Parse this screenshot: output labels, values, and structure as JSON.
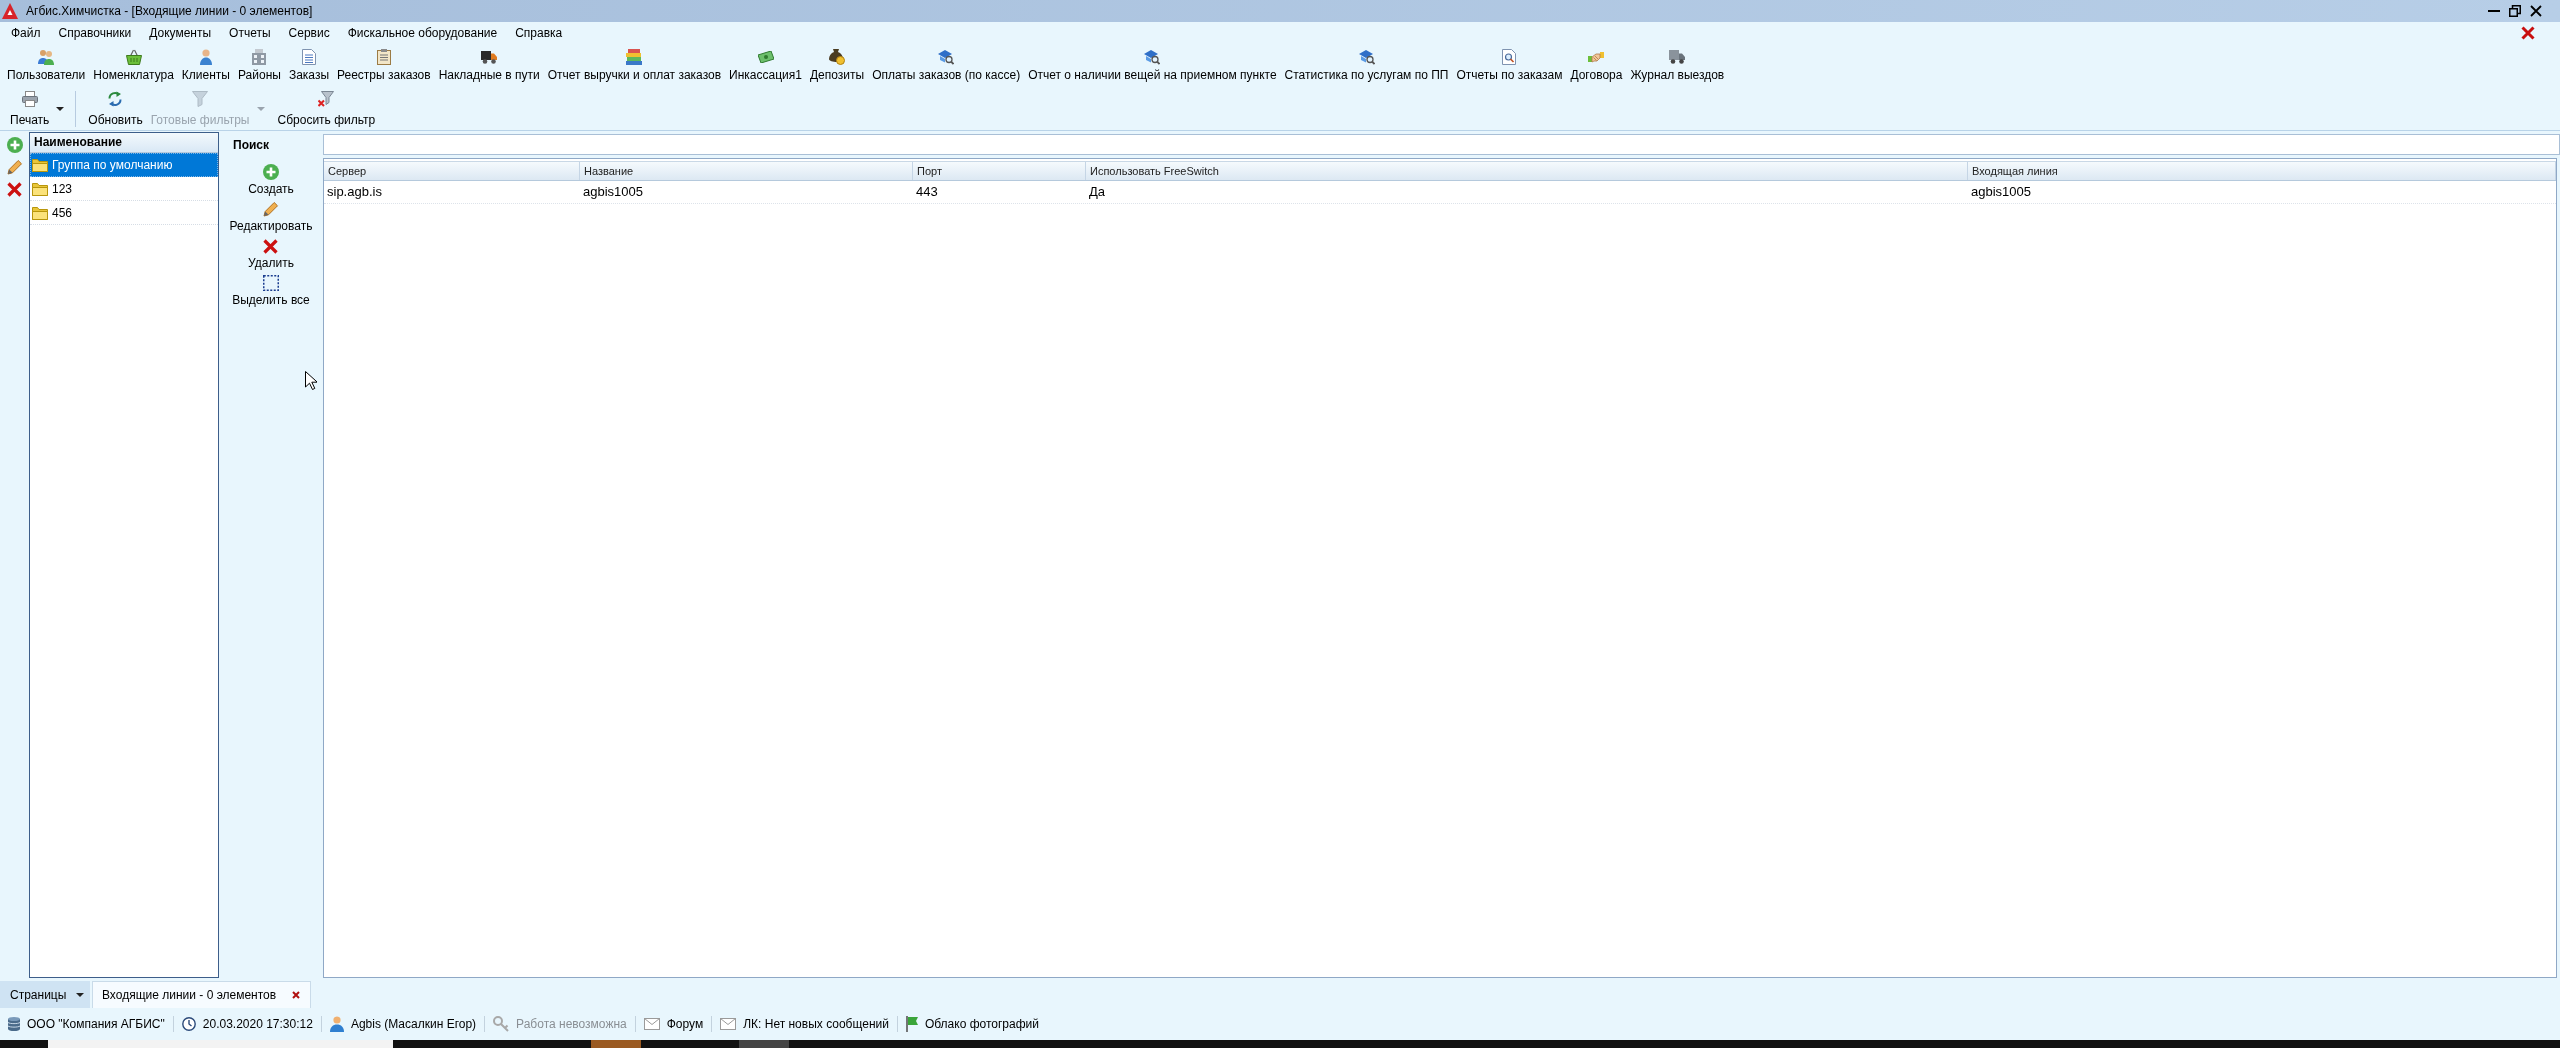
{
  "window": {
    "title": "Агбис.Химчистка - [Входящие линии - 0 элементов]"
  },
  "menu": [
    "Файл",
    "Справочники",
    "Документы",
    "Отчеты",
    "Сервис",
    "Фискальное оборудование",
    "Справка"
  ],
  "toolbar": [
    "Пользователи",
    "Номенклатура",
    "Клиенты",
    "Районы",
    "Заказы",
    "Реестры заказов",
    "Накладные в пути",
    "Отчет выручки и оплат заказов",
    "Инкассация1",
    "Депозиты",
    "Оплаты заказов (по кассе)",
    "Отчет о наличии вещей на приемном пункте",
    "Статистика по услугам по ПП",
    "Отчеты по заказам",
    "Договора",
    "Журнал выездов"
  ],
  "action_groups": [
    [
      {
        "label": "Печать",
        "disabled": false,
        "dropdown": true
      }
    ],
    [
      {
        "label": "Обновить",
        "disabled": false,
        "dropdown": false
      },
      {
        "label": "Готовые фильтры",
        "disabled": true,
        "dropdown": true
      },
      {
        "label": "Сбросить фильтр",
        "disabled": false,
        "dropdown": false
      }
    ]
  ],
  "tree": {
    "header": "Наименование",
    "items": [
      {
        "label": "Группа по умолчанию",
        "selected": true
      },
      {
        "label": "123",
        "selected": false
      },
      {
        "label": "456",
        "selected": false
      }
    ]
  },
  "search_panel": {
    "title": "Поиск",
    "buttons": [
      "Создать",
      "Редактировать",
      "Удалить",
      "Выделить все"
    ]
  },
  "table": {
    "columns": [
      "Сервер",
      "Название",
      "Порт",
      "Использовать FreeSwitch",
      "Входящая линия"
    ],
    "rows": [
      [
        "sip.agb.is",
        "agbis1005",
        "443",
        "Да",
        "agbis1005"
      ]
    ]
  },
  "page_tabs": {
    "menu_label": "Страницы",
    "tabs": [
      {
        "label": "Входящие линии - 0 элементов",
        "selected": true
      }
    ]
  },
  "status_bar": [
    {
      "text": "ООО \"Компания АГБИС\"",
      "disabled": false
    },
    {
      "text": "20.03.2020 17:30:12",
      "disabled": false
    },
    {
      "text": "Agbis (Масалкин Егор)",
      "disabled": false
    },
    {
      "text": "Работа невозможна",
      "disabled": true
    },
    {
      "text": "Форум",
      "disabled": false
    },
    {
      "text": "ЛК: Нет новых сообщений",
      "disabled": false
    },
    {
      "text": "Облако фотографий",
      "disabled": false
    }
  ]
}
